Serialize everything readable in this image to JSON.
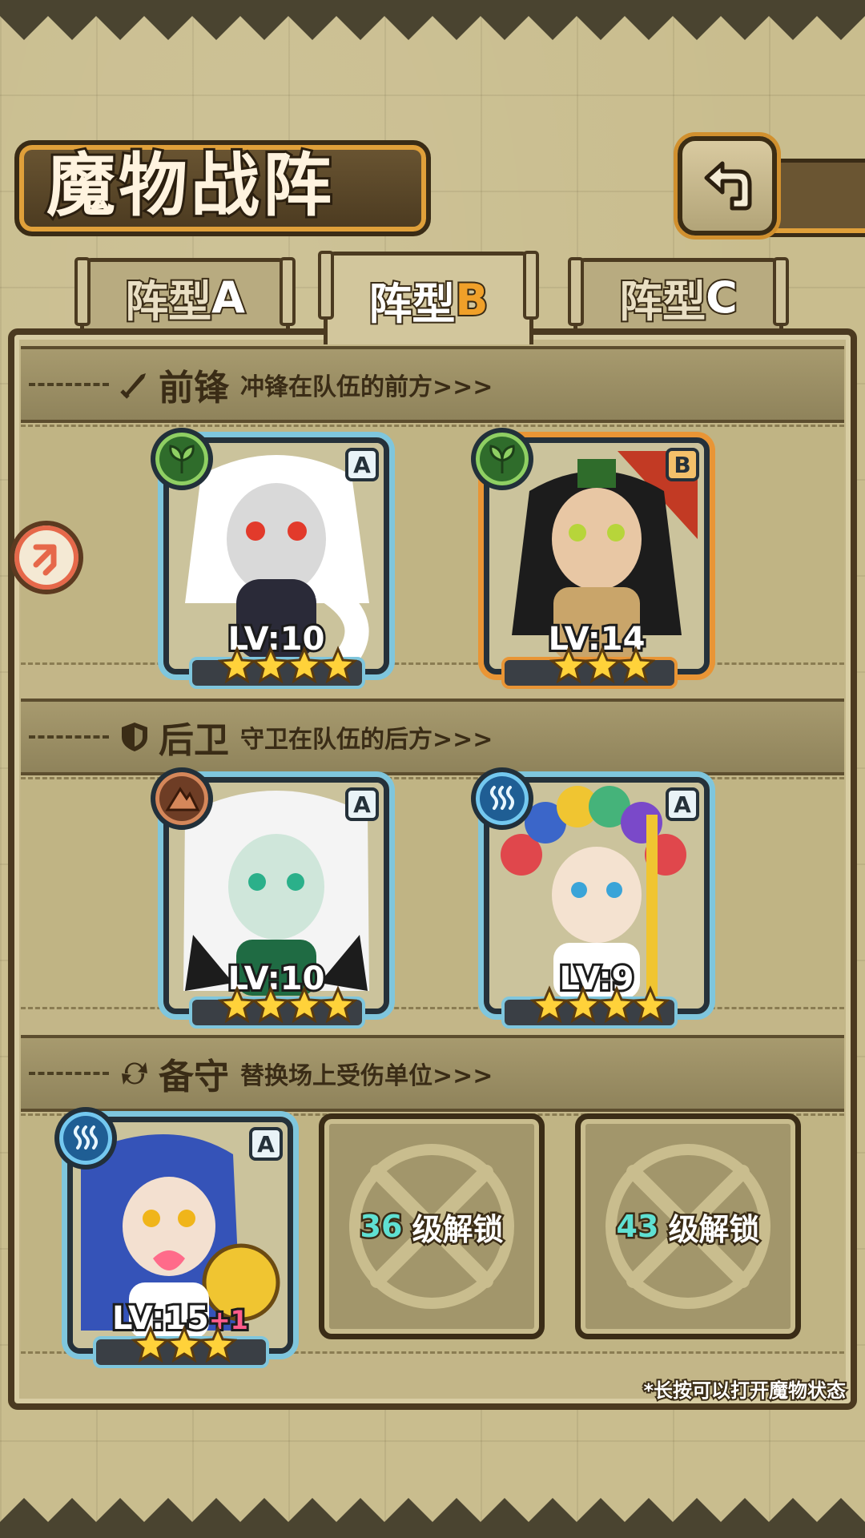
{
  "title": "魔物战阵",
  "tabs": [
    {
      "prefix": "阵型",
      "letter": "A",
      "active": false
    },
    {
      "prefix": "阵型",
      "letter": "B",
      "active": true
    },
    {
      "prefix": "阵型",
      "letter": "C",
      "active": false
    }
  ],
  "sections": {
    "front": {
      "title": "前锋",
      "desc": "冲锋在队伍的前方>>>",
      "icon": "sword-icon"
    },
    "rear": {
      "title": "后卫",
      "desc": "守卫在队伍的后方>>>",
      "icon": "shield-icon"
    },
    "reserve": {
      "title": "备守",
      "desc": "替换场上受伤单位>>>",
      "icon": "swap-icon"
    }
  },
  "units": {
    "front1": {
      "rank": "A",
      "level": "LV:10",
      "stars": 4,
      "element": "plant-icon",
      "bonus": ""
    },
    "front2": {
      "rank": "B",
      "level": "LV:14",
      "stars": 3,
      "element": "plant-icon",
      "bonus": ""
    },
    "rear1": {
      "rank": "A",
      "level": "LV:10",
      "stars": 4,
      "element": "earth-icon",
      "bonus": ""
    },
    "rear2": {
      "rank": "A",
      "level": "LV:9",
      "stars": 4,
      "element": "water-icon",
      "bonus": ""
    },
    "reserve1": {
      "rank": "A",
      "level": "LV:15",
      "stars": 3,
      "element": "water-icon",
      "bonus": "+1"
    }
  },
  "locked_slots": [
    {
      "level": "36",
      "label": "级解锁"
    },
    {
      "level": "43",
      "label": "级解锁"
    }
  ],
  "hint": "*长按可以打开魔物状态",
  "colors": {
    "panel": "#c3b688",
    "frame": "#4b3a20",
    "accent_orange": "#f0a029",
    "card_blue": "#7fc6dd",
    "card_orange": "#e99535"
  }
}
